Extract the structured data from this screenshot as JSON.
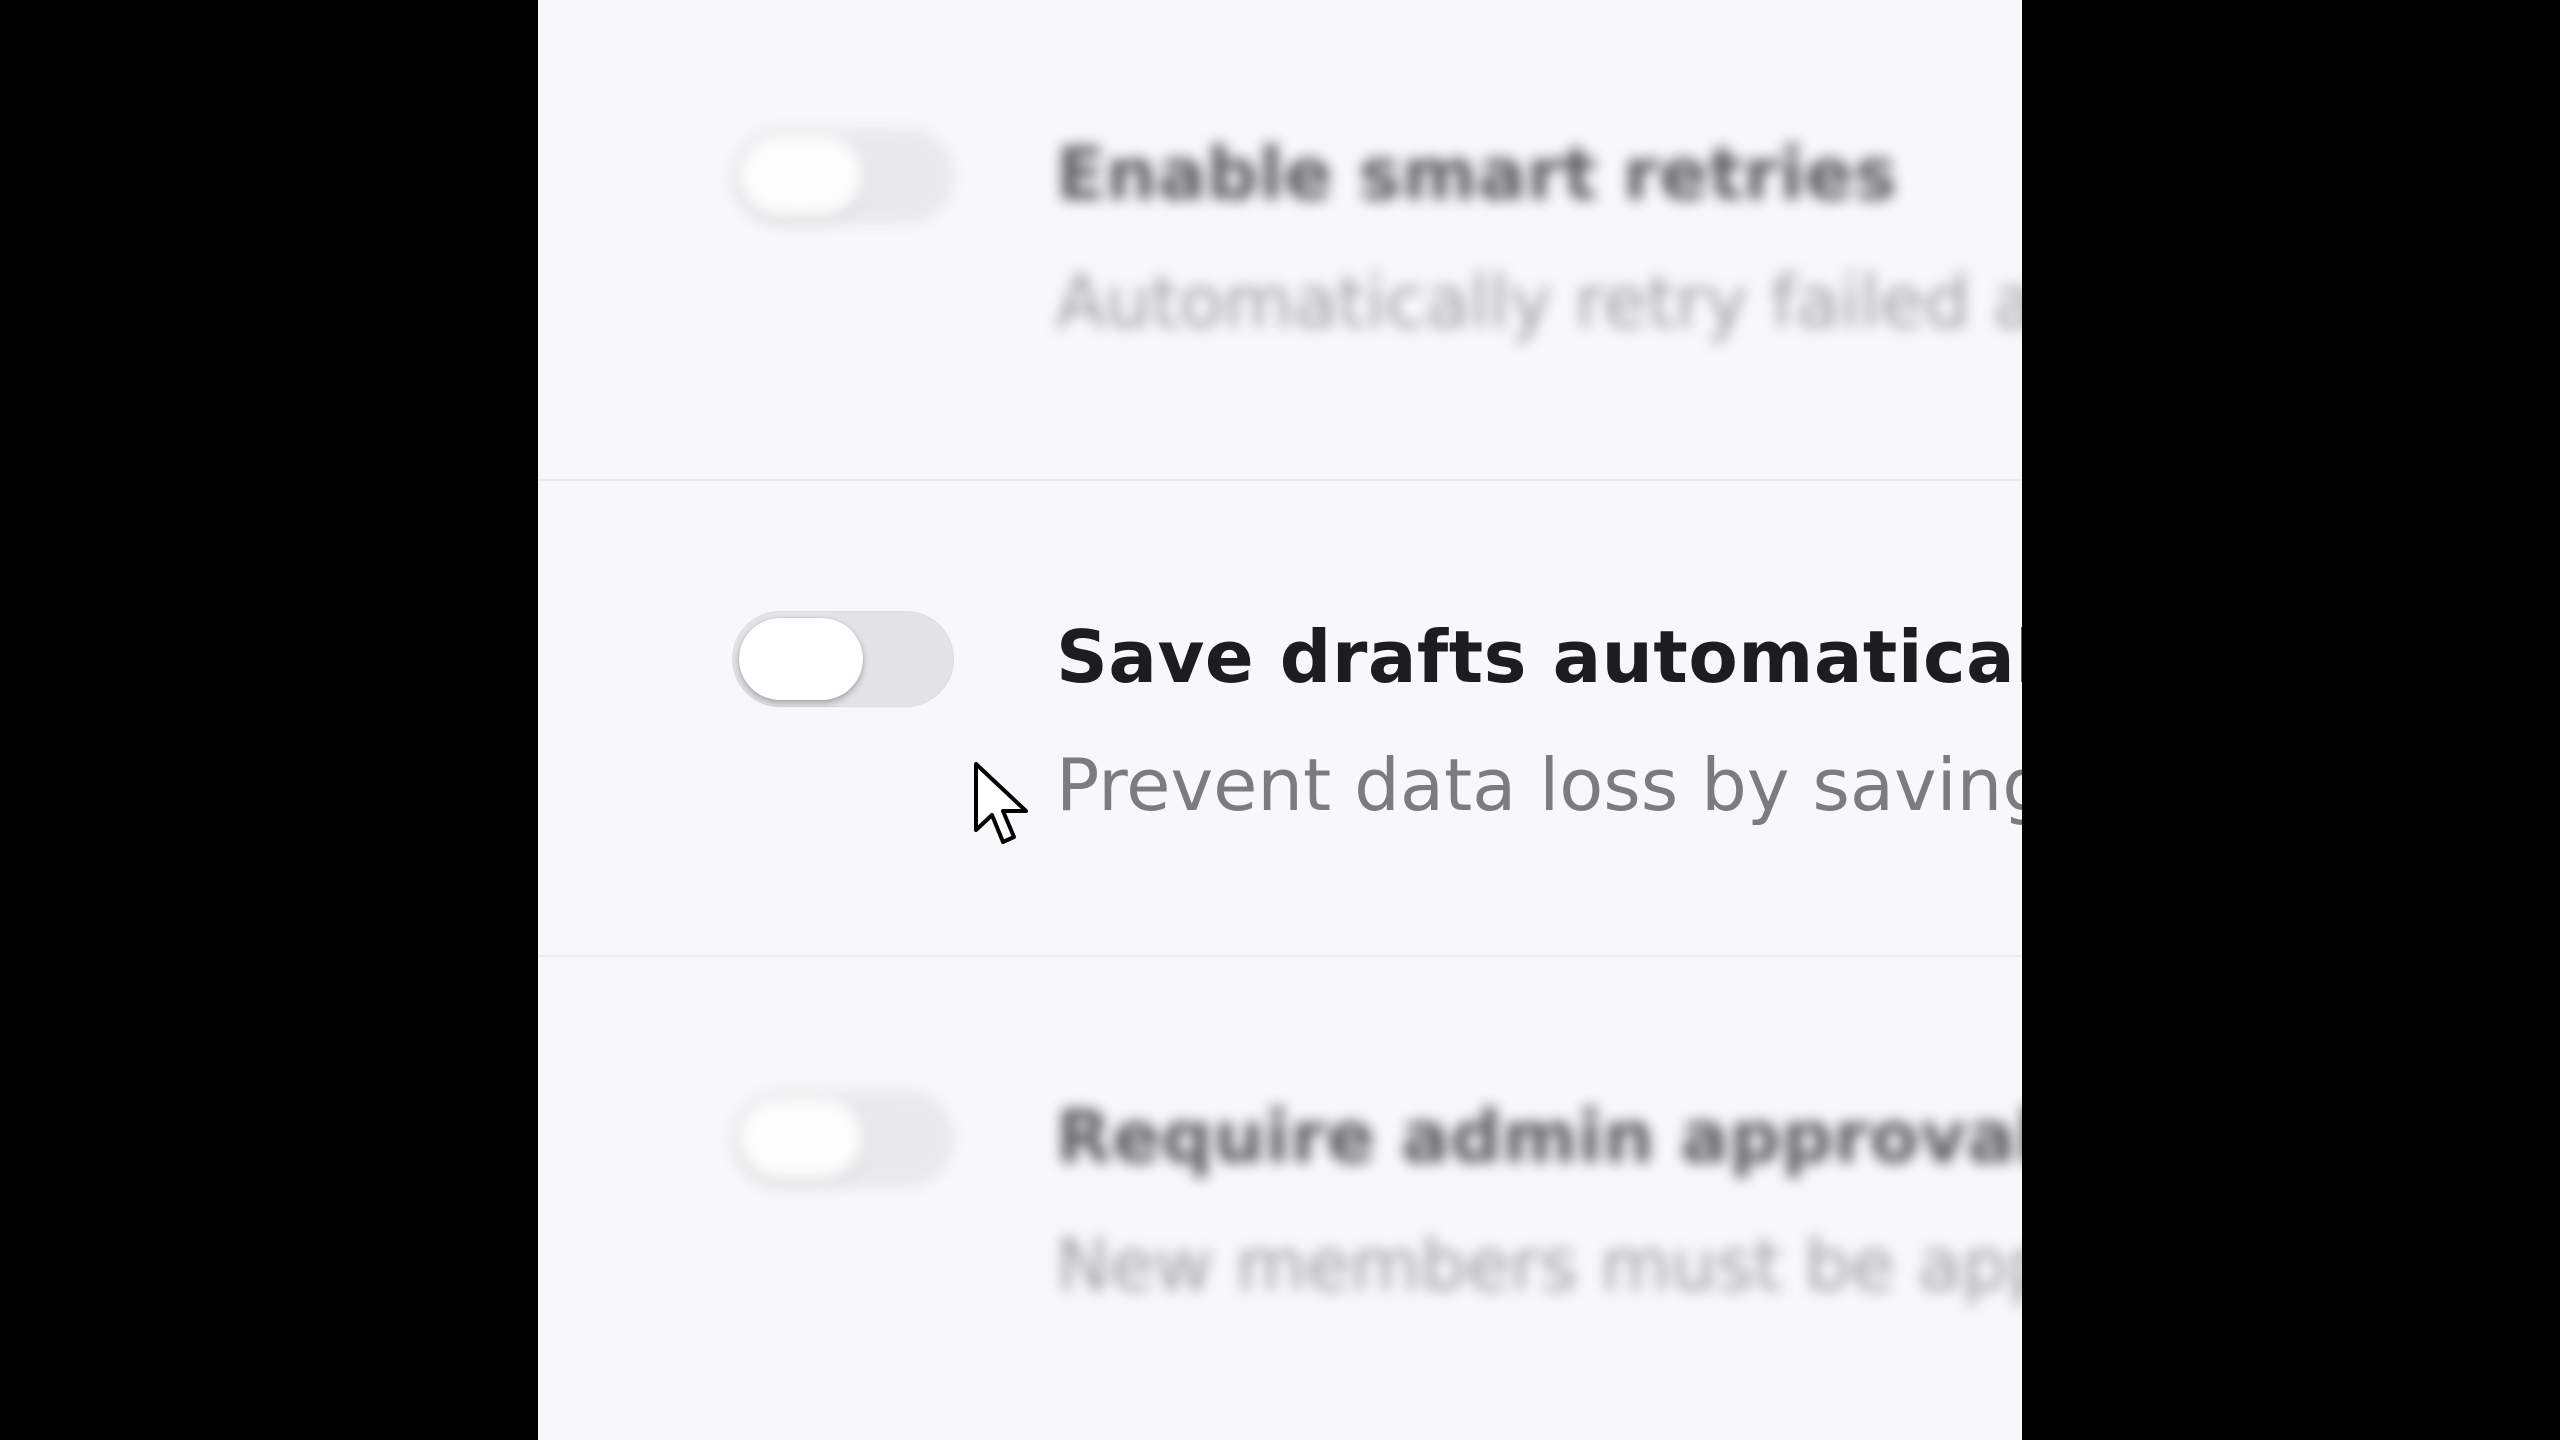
{
  "settings": {
    "rows": [
      {
        "title": "Enable smart retries",
        "subtitle": "Automatically retry failed ac",
        "enabled": false,
        "focused": false
      },
      {
        "title": "Save drafts automatically",
        "subtitle": "Prevent data loss by saving",
        "enabled": false,
        "focused": true
      },
      {
        "title": "Require admin approval",
        "subtitle": "New members must be app",
        "enabled": false,
        "focused": false
      }
    ]
  },
  "colors": {
    "background": "#f8f8fa",
    "letterbox": "#000000",
    "toggle_off_track": "#e4e4e8",
    "title_text": "#1d1d1f",
    "subtitle_text": "#7b7b80"
  },
  "icons": {
    "cursor": "arrow-pointer-icon"
  }
}
